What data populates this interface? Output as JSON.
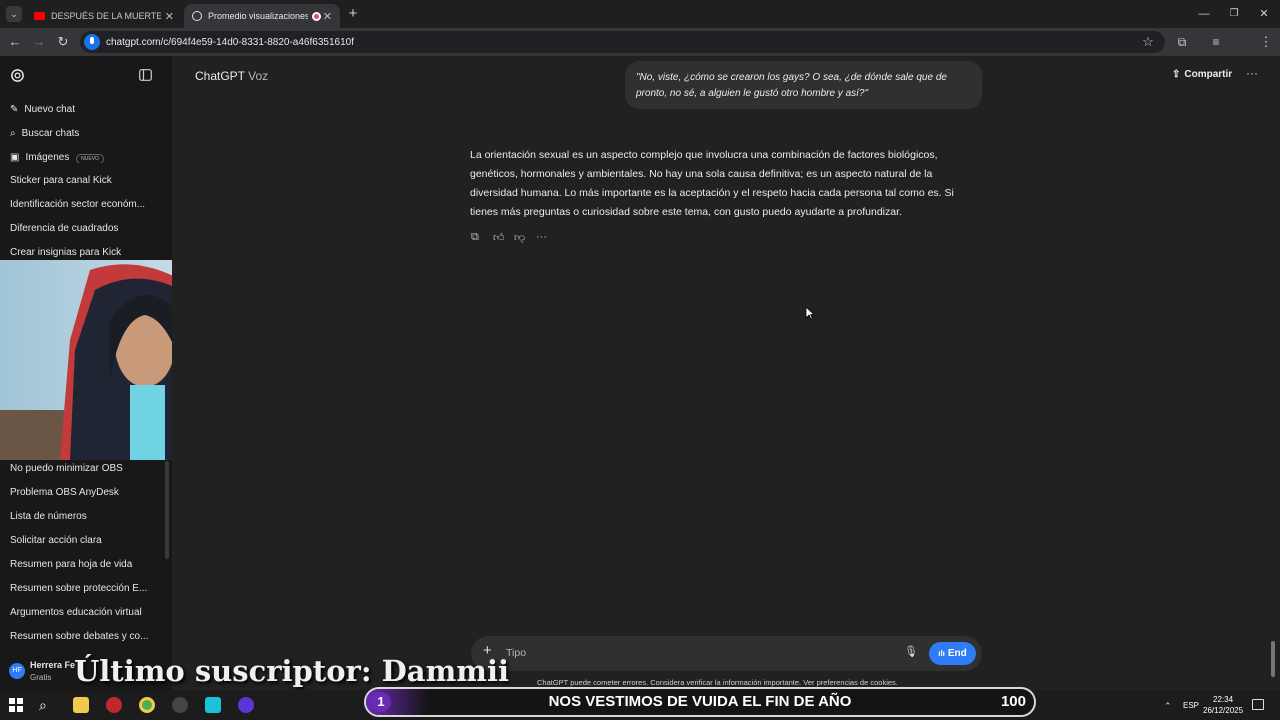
{
  "browser": {
    "tabs": [
      {
        "title": "DESPUÉS DE LA MUERTE | DOC"
      },
      {
        "title": "Promedio visualizaciones G"
      }
    ],
    "url": "chatgpt.com/c/694f4e59-14d0-8331-8820-a46f6351610f"
  },
  "sidebar": {
    "nuevo_chat": "Nuevo chat",
    "buscar_chats": "Buscar chats",
    "imagenes": "Imágenes",
    "imagenes_badge": "NUEVO",
    "chats_top": [
      "Sticker para canal Kick",
      "Identificación sector económ...",
      "Diferencia de cuadrados",
      "Crear insignias para Kick"
    ],
    "chats_bottom": [
      "No puedo minimizar OBS",
      "Problema OBS AnyDesk",
      "Lista de números",
      "Solicitar acción clara",
      "Resumen para hoja de vida",
      "Resumen sobre protección E...",
      "Argumentos educación virtual",
      "Resumen sobre debates y co..."
    ],
    "user": {
      "initials": "HF",
      "name": "Herrera Fe",
      "plan": "Gratis"
    }
  },
  "header": {
    "model": "ChatGPT",
    "mode": "Voz",
    "share_label": "Compartir"
  },
  "conversation": {
    "user_message": "\"No, viste, ¿cómo se crearon los gays? O sea, ¿de dónde sale que de pronto, no sé, a alguien le gustó otro hombre y así?\"",
    "assistant_message": "La orientación sexual es un aspecto complejo que involucra una combinación de factores biológicos, genéticos, hormonales y ambientales. No hay una sola causa definitiva; es un aspecto natural de la diversidad humana. Lo más importante es la aceptación y el respeto hacia cada persona tal como es. Si tienes más preguntas o curiosidad sobre este tema, con gusto puedo ayudarte a profundizar."
  },
  "composer": {
    "placeholder": "Tipo",
    "end_label": "End",
    "disclaimer": "ChatGPT puede cometer errores. Considera verificar la información importante. Ver preferencias de cookies."
  },
  "overlay": {
    "subscriber": "Último suscriptor: Dammii",
    "goal_number": "1",
    "goal_text": "NOS VESTIMOS DE VUIDA EL FIN DE AÑO",
    "goal_target": "100"
  },
  "taskbar": {
    "lang": "ESP",
    "time": "22:34",
    "date": "26/12/2025"
  },
  "colors": {
    "accent_blue": "#2f7cf6",
    "goal_purple": "#6a2bb5"
  }
}
